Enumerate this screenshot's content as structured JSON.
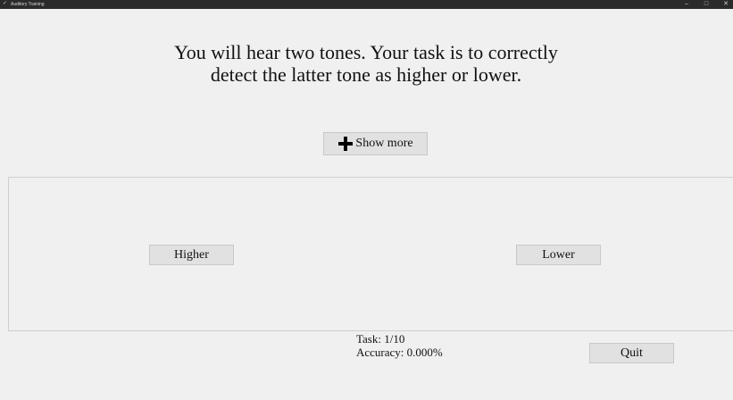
{
  "window": {
    "title": "Auditory Training",
    "controls": {
      "minimize": "–",
      "maximize": "□",
      "close": "✕"
    }
  },
  "instructions": {
    "line1": "You will hear two tones. Your task is to correctly",
    "line2": "detect the latter tone as higher or lower."
  },
  "show_more": {
    "label": "Show more",
    "icon": "plus-icon"
  },
  "answers": {
    "higher_label": "Higher",
    "lower_label": "Lower"
  },
  "status": {
    "task": "Task: 1/10",
    "accuracy": "Accuracy: 0.000%"
  },
  "quit_label": "Quit"
}
